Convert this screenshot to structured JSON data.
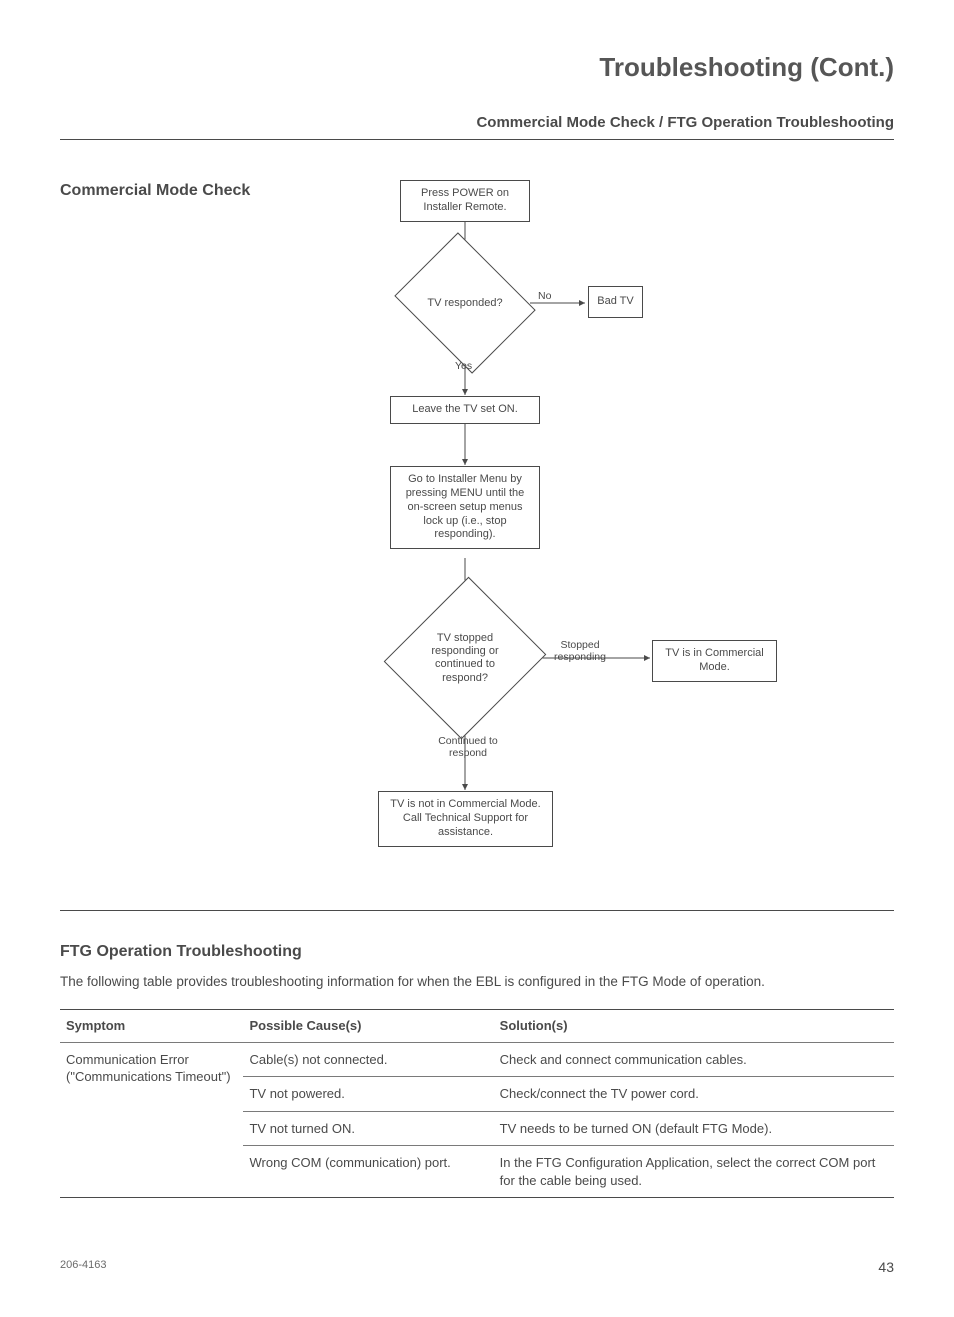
{
  "page_title": "Troubleshooting (Cont.)",
  "subtitle": "Commercial Mode Check / FTG Operation Troubleshooting",
  "flowchart_heading": "Commercial Mode Check",
  "flow": {
    "start": "Press POWER on Installer Remote.",
    "q1": "TV responded?",
    "q1_no": "No",
    "q1_yes": "Yes",
    "badtv": "Bad TV",
    "leave_on": "Leave the TV set ON.",
    "installer_menu": "Go to Installer Menu by pressing MENU until the on-screen setup menus lock up (i.e., stop responding).",
    "q2": "TV stopped responding or continued to respond?",
    "q2_stopped": "Stopped responding",
    "q2_continued": "Continued to respond",
    "commercial": "TV is in Commercial Mode.",
    "not_commercial": "TV is not in Commercial Mode. Call Technical Support for assistance."
  },
  "ftg": {
    "heading": "FTG Operation Troubleshooting",
    "intro": "The following table provides troubleshooting information for when the EBL is configured in the FTG Mode of operation.",
    "headers": {
      "symptom": "Symptom",
      "cause": "Possible Cause(s)",
      "solution": "Solution(s)"
    },
    "symptom": "Communication Error (\"Communications Timeout\")",
    "rows": [
      {
        "cause": "Cable(s) not connected.",
        "solution": "Check and connect communication cables."
      },
      {
        "cause": "TV not powered.",
        "solution": "Check/connect the TV power cord."
      },
      {
        "cause": "TV not turned ON.",
        "solution": "TV needs to be turned ON (default FTG Mode)."
      },
      {
        "cause": "Wrong COM (communication) port.",
        "solution": "In the FTG Configuration Application, select the correct COM port for the cable being used."
      }
    ]
  },
  "footer": {
    "docnum": "206-4163",
    "page": "43"
  }
}
